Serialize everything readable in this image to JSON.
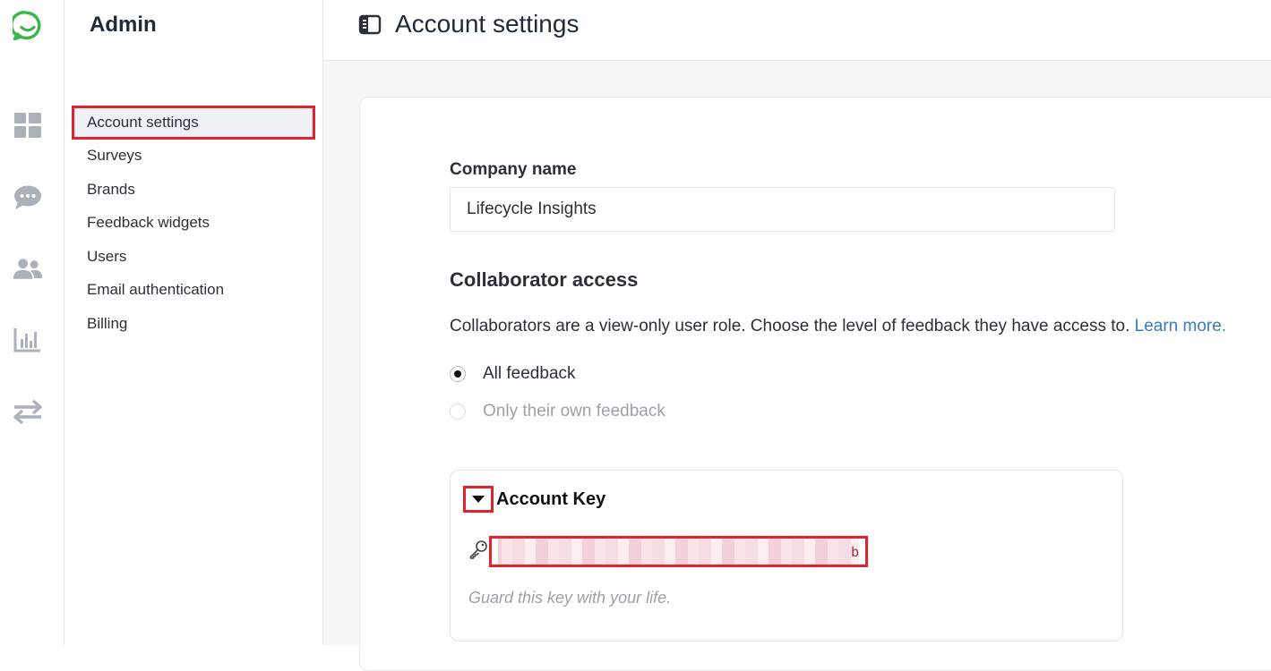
{
  "rail": {
    "icons": [
      "chat-logo-icon",
      "dashboard-icon",
      "feedback-icon",
      "people-icon",
      "analytics-icon",
      "integrations-icon"
    ],
    "brand_color": "#3ab54a"
  },
  "sidebar": {
    "title": "Admin",
    "items": [
      {
        "label": "Account settings",
        "active": true
      },
      {
        "label": "Surveys"
      },
      {
        "label": "Brands"
      },
      {
        "label": "Feedback widgets"
      },
      {
        "label": "Users"
      },
      {
        "label": "Email authentication"
      },
      {
        "label": "Billing"
      }
    ]
  },
  "header": {
    "title": "Account settings",
    "icon": "sidebar-layout-icon"
  },
  "main": {
    "company_name_label": "Company name",
    "company_name_value": "Lifecycle Insights",
    "collaborator_title": "Collaborator access",
    "collaborator_desc": "Collaborators are a view-only user role. Choose the level of feedback they have access to.",
    "learn_more": "Learn more.",
    "options": [
      {
        "label": "All feedback",
        "checked": true,
        "disabled": false
      },
      {
        "label": "Only their own feedback",
        "checked": false,
        "disabled": true
      }
    ],
    "account_key": {
      "title": "Account Key",
      "visible_char": "b",
      "hint": "Guard this key with your life."
    }
  },
  "colors": {
    "highlight": "#e0232e",
    "link": "#3a7bbf",
    "icon_gray": "#aab1ba"
  }
}
